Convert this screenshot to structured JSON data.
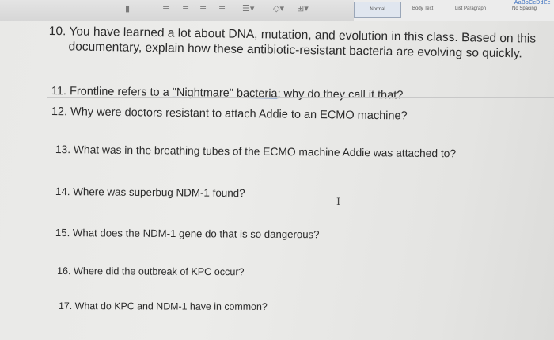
{
  "ribbon": {
    "styles": {
      "normal": "Normal",
      "body_text": "Body Text",
      "list_paragraph": "List Paragraph",
      "no_spacing": "No Spacing"
    }
  },
  "questions": {
    "q10": {
      "line1": "10. You have learned a lot about DNA, mutation, and evolution in this class. Based on this",
      "line2": "documentary, explain how these antibiotic-resistant bacteria are evolving so quickly."
    },
    "q11": {
      "before": "11. Frontline refers to a ",
      "link": "\"Nightmare\" bacteria",
      "after": "; why do they call it that?"
    },
    "q12": "12. Why were doctors resistant to attach Addie to an ECMO machine?",
    "q13": "13. What was in the breathing tubes of the ECMO machine Addie was attached to?",
    "q14": "14. Where was superbug NDM-1 found?",
    "q15": "15. What does the NDM-1 gene do that is so dangerous?",
    "q16": "16. Where did the outbreak of KPC occur?",
    "q17": "17. What do KPC and NDM-1 have in common?"
  },
  "colors": {
    "ribbon_bg": "#dcdcdc",
    "page_bg": "#e9e9e7",
    "text": "#2b2b2b",
    "link_underline": "#4a78c8"
  }
}
